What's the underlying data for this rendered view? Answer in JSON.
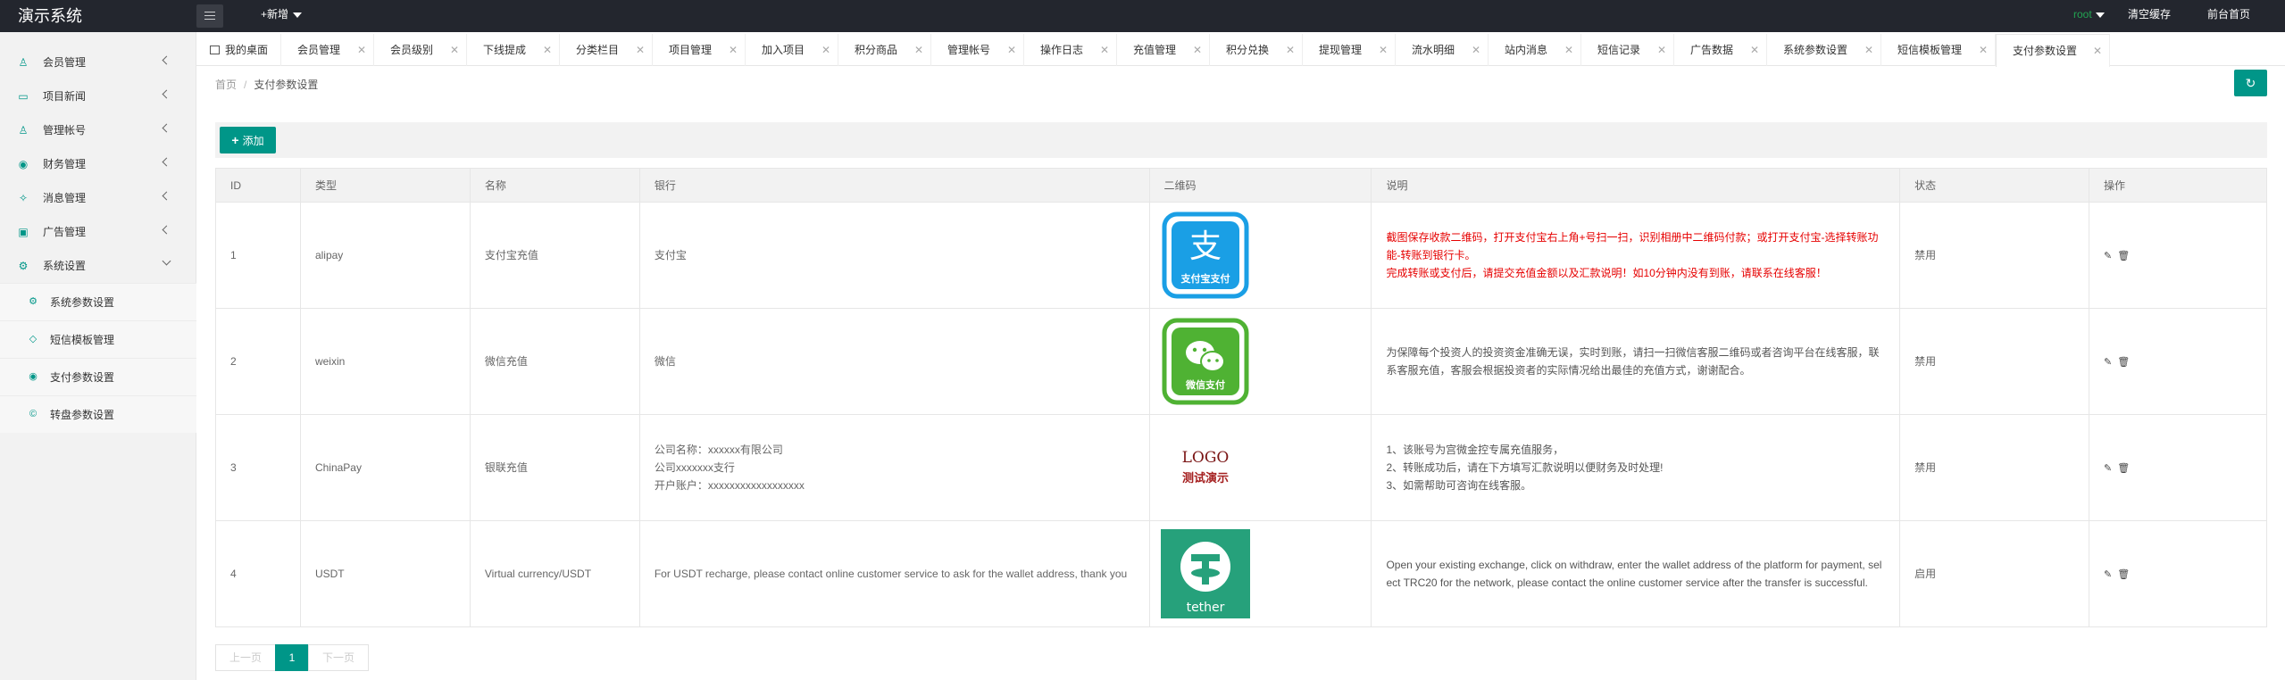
{
  "app": {
    "title": "演示系统"
  },
  "header": {
    "add_new": "+新增",
    "user": "root",
    "clear_cache": "清空缓存",
    "front_page": "前台首页"
  },
  "sidebar": {
    "items": [
      {
        "label": "会员管理",
        "icon": "user-icon"
      },
      {
        "label": "项目新闻",
        "icon": "book-icon"
      },
      {
        "label": "管理帐号",
        "icon": "admin-icon"
      },
      {
        "label": "财务管理",
        "icon": "finance-icon"
      },
      {
        "label": "消息管理",
        "icon": "message-icon"
      },
      {
        "label": "广告管理",
        "icon": "image-icon"
      },
      {
        "label": "系统设置",
        "icon": "gear-icon"
      }
    ],
    "sub_items": [
      {
        "label": "系统参数设置",
        "icon": "gear-icon"
      },
      {
        "label": "短信模板管理",
        "icon": "tag-icon"
      },
      {
        "label": "支付参数设置",
        "icon": "pay-icon"
      },
      {
        "label": "转盘参数设置",
        "icon": "coin-icon"
      }
    ]
  },
  "tabs": [
    {
      "label": "我的桌面"
    },
    {
      "label": "会员管理"
    },
    {
      "label": "会员级别"
    },
    {
      "label": "下线提成"
    },
    {
      "label": "分类栏目"
    },
    {
      "label": "项目管理"
    },
    {
      "label": "加入项目"
    },
    {
      "label": "积分商品"
    },
    {
      "label": "管理帐号"
    },
    {
      "label": "操作日志"
    },
    {
      "label": "充值管理"
    },
    {
      "label": "积分兑换"
    },
    {
      "label": "提现管理"
    },
    {
      "label": "流水明细"
    },
    {
      "label": "站内消息"
    },
    {
      "label": "短信记录"
    },
    {
      "label": "广告数据"
    },
    {
      "label": "系统参数设置"
    },
    {
      "label": "短信模板管理"
    },
    {
      "label": "支付参数设置"
    }
  ],
  "breadcrumb": {
    "home": "首页",
    "sep": "/",
    "current": "支付参数设置"
  },
  "toolbar": {
    "add_label": "添加"
  },
  "table": {
    "columns": [
      "ID",
      "类型",
      "名称",
      "银行",
      "二维码",
      "说明",
      "状态",
      "操作"
    ],
    "rows": [
      {
        "id": "1",
        "type": "alipay",
        "name": "支付宝充值",
        "bank": [
          "支付宝"
        ],
        "qr_caption": "支付宝支付",
        "desc": [
          "截图保存收款二维码，打开支付宝右上角+号扫一扫，识别相册中二维码付款；或打开支付宝-选择转账功",
          "能-转账到银行卡。",
          "完成转账或支付后，请提交充值金额以及汇款说明！如10分钟内没有到账，请联系在线客服！"
        ],
        "status": "禁用"
      },
      {
        "id": "2",
        "type": "weixin",
        "name": "微信充值",
        "bank": [
          "微信"
        ],
        "qr_caption": "微信支付",
        "desc": [
          "为保障每个投资人的投资资金准确无误，实时到账，请扫一扫微信客服二维码或者咨询平台在线客服，联",
          "系客服充值，客服会根据投资者的实际情况给出最佳的充值方式，谢谢配合。"
        ],
        "status": "禁用"
      },
      {
        "id": "3",
        "type": "ChinaPay",
        "name": "银联充值",
        "bank": [
          "公司名称：xxxxxx有限公司",
          "公司xxxxxxx支行",
          "开户账户：xxxxxxxxxxxxxxxxxx"
        ],
        "qr_caption": "LOGO",
        "qr_caption2": "测试演示",
        "desc": [
          "1、该账号为宫微金控专属充值服务，",
          "2、转账成功后，请在下方填写汇款说明以便财务及时处理!",
          "3、如需帮助可咨询在线客服。"
        ],
        "status": "禁用"
      },
      {
        "id": "4",
        "type": "USDT",
        "name": "Virtual currency/USDT",
        "bank": [
          "For USDT recharge, please contact online customer service to ask for the wallet address, thank you"
        ],
        "qr_caption": "tether",
        "desc": [
          "Open your existing exchange, click on withdraw, enter the wallet address of the platform for payment, sel",
          "ect TRC20 for the network, please contact the online customer service after the transfer is successful."
        ],
        "status": "启用"
      }
    ]
  },
  "pagination": {
    "prev": "上一页",
    "current": "1",
    "next": "下一页"
  },
  "colors": {
    "accent": "#009688",
    "header_bg": "#23262e",
    "alipay_blue": "#1a9fe5",
    "wechat_green": "#4fb233",
    "tether_teal": "#26a17b",
    "red_text": "#e60000"
  }
}
